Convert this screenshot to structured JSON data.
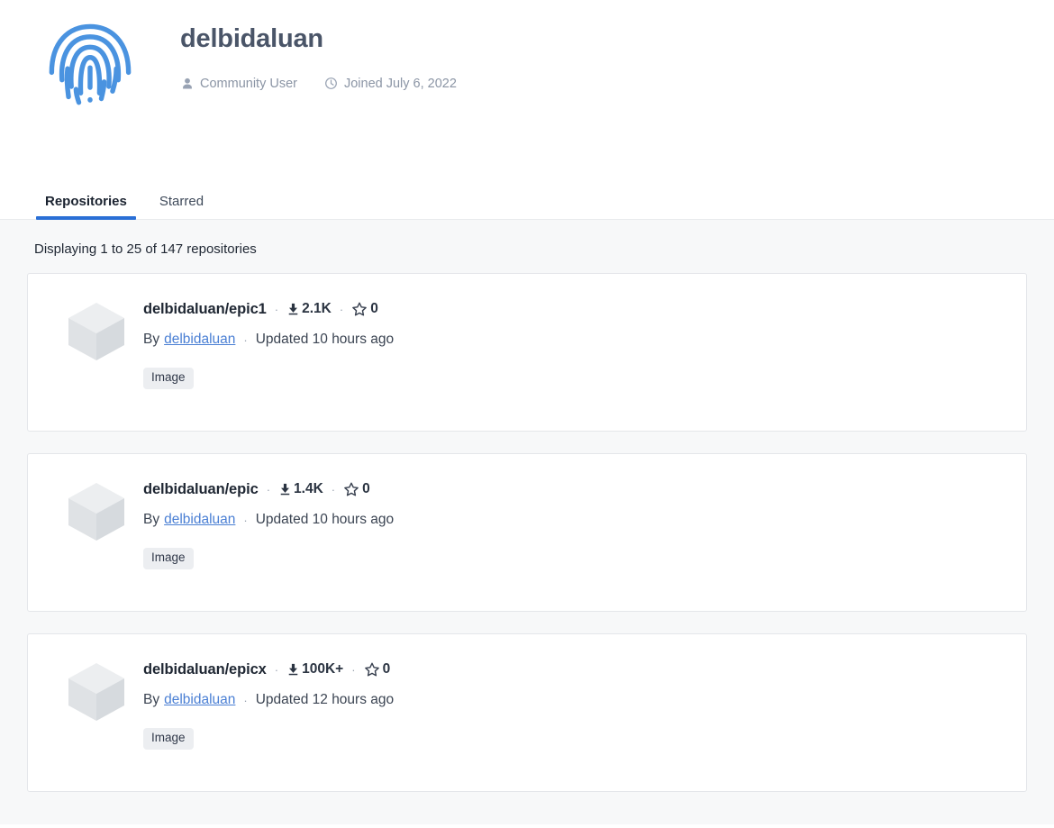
{
  "profile": {
    "avatar_icon": "fingerprint-icon",
    "avatar_color": "#4a93e0",
    "username": "delbidaluan",
    "meta": [
      {
        "icon": "person-icon",
        "label": "Community User"
      },
      {
        "icon": "clock-icon",
        "label": "Joined July 6, 2022"
      }
    ]
  },
  "tabs": [
    {
      "label": "Repositories",
      "active": true
    },
    {
      "label": "Starred",
      "active": false
    }
  ],
  "accent_color": "#2a6fd6",
  "results": {
    "count_text": "Displaying 1 to 25 of 147 repositories"
  },
  "repositories": [
    {
      "icon": "cube-icon",
      "name": "delbidaluan/epic1",
      "separator": "·",
      "downloads_icon": "download-icon",
      "downloads": "2.1K",
      "stars_icon": "star-icon",
      "stars": "0",
      "by_label": "By",
      "owner": "delbidaluan",
      "updated": "Updated 10 hours ago",
      "badge": "Image"
    },
    {
      "icon": "cube-icon",
      "name": "delbidaluan/epic",
      "separator": "·",
      "downloads_icon": "download-icon",
      "downloads": "1.4K",
      "stars_icon": "star-icon",
      "stars": "0",
      "by_label": "By",
      "owner": "delbidaluan",
      "updated": "Updated 10 hours ago",
      "badge": "Image"
    },
    {
      "icon": "cube-icon",
      "name": "delbidaluan/epicx",
      "separator": "·",
      "downloads_icon": "download-icon",
      "downloads": "100K+",
      "stars_icon": "star-icon",
      "stars": "0",
      "by_label": "By",
      "owner": "delbidaluan",
      "updated": "Updated 12 hours ago",
      "badge": "Image"
    }
  ]
}
